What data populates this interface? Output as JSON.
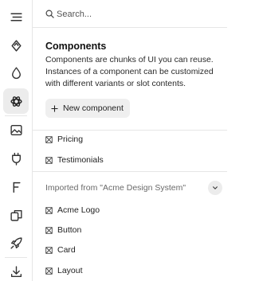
{
  "search": {
    "placeholder": "Search...",
    "value": ""
  },
  "intro": {
    "title": "Components",
    "description": "Components are chunks of UI you can reuse. Instances of a component can be customized with different variants or slot contents."
  },
  "new_component_button": {
    "label": "New component"
  },
  "local_components": [
    {
      "label": "Pricing"
    },
    {
      "label": "Testimonials"
    }
  ],
  "imported_section": {
    "label": "Imported from  \"Acme Design System\"",
    "items": [
      {
        "label": "Acme Logo"
      },
      {
        "label": "Button"
      },
      {
        "label": "Card"
      },
      {
        "label": "Layout"
      }
    ]
  },
  "rail": {
    "items": [
      {
        "icon": "menu-icon"
      },
      {
        "icon": "diamond-icon"
      },
      {
        "icon": "drop-icon"
      },
      {
        "icon": "components-icon",
        "active": true
      },
      {
        "icon": "image-icon"
      },
      {
        "icon": "plugin-icon"
      },
      {
        "icon": "font-icon"
      },
      {
        "icon": "layers-icon"
      },
      {
        "icon": "rocket-icon"
      },
      {
        "icon": "download-icon"
      }
    ]
  }
}
